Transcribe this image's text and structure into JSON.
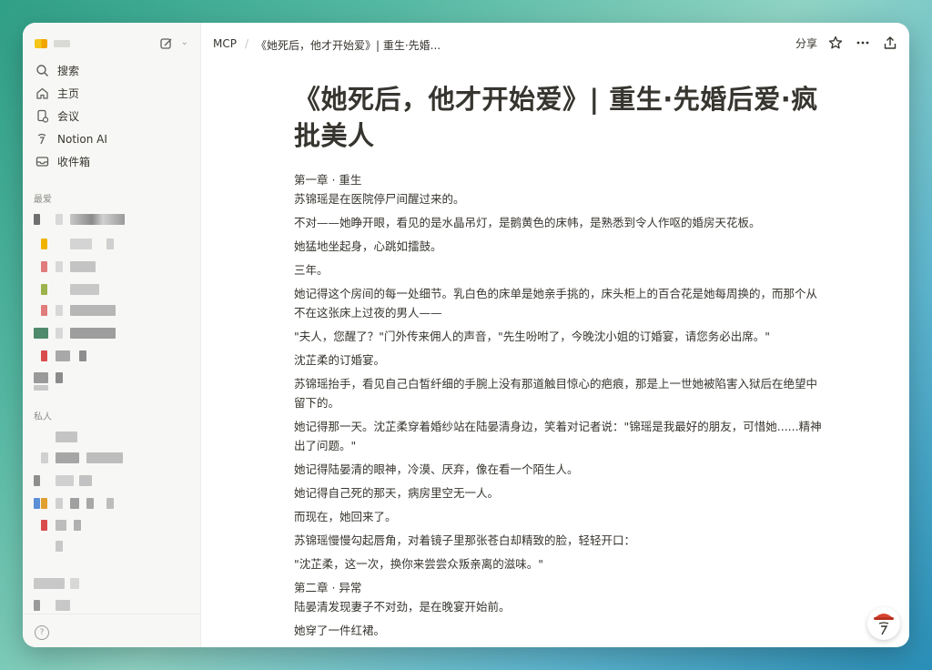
{
  "sidebar": {
    "nav": [
      {
        "label": "搜索",
        "icon": "search-icon"
      },
      {
        "label": "主页",
        "icon": "home-icon"
      },
      {
        "label": "会议",
        "icon": "meeting-icon"
      },
      {
        "label": "Notion AI",
        "icon": "notion-ai-icon"
      },
      {
        "label": "收件箱",
        "icon": "inbox-icon"
      }
    ],
    "favorites_label": "最爱",
    "private_label": "私人",
    "help_symbol": "?"
  },
  "breadcrumb": {
    "root": "MCP",
    "separator": "/",
    "page": "《她死后，他才开始爱》| 重生·先婚..."
  },
  "toolbar": {
    "share_label": "分享"
  },
  "page": {
    "title": "《她死后，他才开始爱》| 重生·先婚后爱·疯批美人",
    "paragraphs": [
      "第一章 · 重生",
      "苏锦瑶是在医院停尸间醒过来的。",
      "不对——她睁开眼，看见的是水晶吊灯，是鹅黄色的床帏，是熟悉到令人作呕的婚房天花板。",
      "她猛地坐起身，心跳如擂鼓。",
      "三年。",
      "她记得这个房间的每一处细节。乳白色的床单是她亲手挑的，床头柜上的百合花是她每周换的，而那个从不在这张床上过夜的男人——",
      "\"夫人，您醒了？\"门外传来佣人的声音，\"先生吩咐了，今晚沈小姐的订婚宴，请您务必出席。\"",
      "沈芷柔的订婚宴。",
      "苏锦瑶抬手，看见自己白皙纤细的手腕上没有那道触目惊心的疤痕，那是上一世她被陷害入狱后在绝望中留下的。",
      "她记得那一天。沈芷柔穿着婚纱站在陆晏清身边，笑着对记者说：\"锦瑶是我最好的朋友，可惜她......精神出了问题。\"",
      "她记得陆晏清的眼神，冷漠、厌弃，像在看一个陌生人。",
      "她记得自己死的那天，病房里空无一人。",
      "而现在，她回来了。",
      "苏锦瑶慢慢勾起唇角，对着镜子里那张苍白却精致的脸，轻轻开口：",
      "\"沈芷柔，这一次，换你来尝尝众叛亲离的滋味。\"",
      "第二章 · 异常",
      "陆晏清发现妻子不对劲，是在晚宴开始前。",
      "她穿了一件红裙。"
    ]
  },
  "colors": {
    "window_bg": "#ffffff",
    "sidebar_bg": "#f7f7f5",
    "text": "#37352f",
    "muted": "#8d8c88"
  }
}
